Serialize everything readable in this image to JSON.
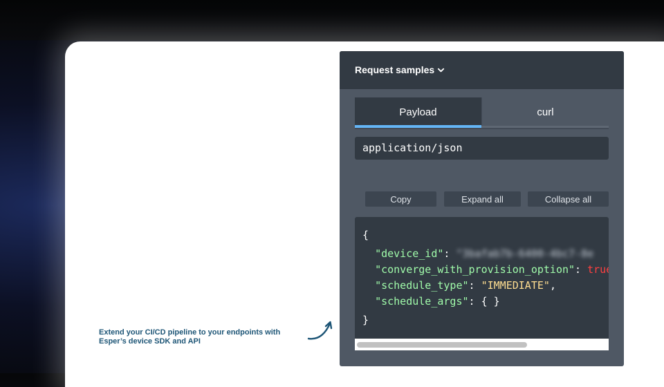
{
  "annotation": {
    "line1": "Extend your CI/CD pipeline to your endpoints with",
    "line2": "Esper’s device SDK and API",
    "icon": "curved-arrow-icon"
  },
  "panel": {
    "title": "Request samples",
    "title_icon": "chevron-down-icon",
    "tabs": [
      {
        "label": "Payload",
        "active": true
      },
      {
        "label": "curl",
        "active": false
      }
    ],
    "content_type": "application/json",
    "buttons": {
      "copy": "Copy",
      "expand_all": "Expand all",
      "collapse_all": "Collapse all"
    },
    "code": {
      "open_brace": "{",
      "close_brace": "}",
      "fields": [
        {
          "key": "\"device_id\"",
          "sep": ": ",
          "value": "\"3bafab7b-6400-4bc7-8e",
          "value_style": "blurred"
        },
        {
          "key": "\"converge_with_provision_option\"",
          "sep": ": ",
          "value": "true",
          "value_style": "bool"
        },
        {
          "key": "\"schedule_type\"",
          "sep": ": ",
          "value": "\"IMMEDIATE\"",
          "value_style": "string",
          "trail": ","
        },
        {
          "key": "\"schedule_args\"",
          "sep": ": ",
          "value": "{ }",
          "value_style": "plain"
        }
      ]
    },
    "accent_color": "#64b5f6",
    "scrollbar_position": 0.0
  }
}
